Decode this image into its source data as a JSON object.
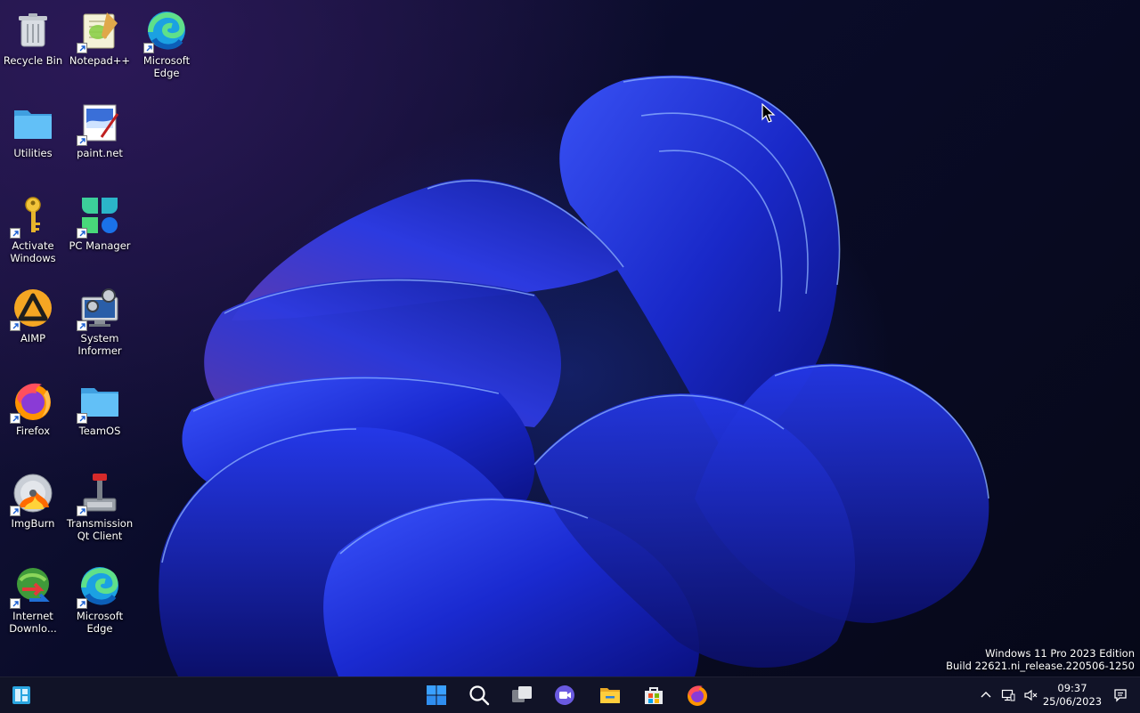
{
  "desktop": {
    "icons": [
      {
        "label": "Recycle Bin",
        "icon": "recycle-bin-icon"
      },
      {
        "label": "Notepad++",
        "icon": "notepad-plus-plus-icon"
      },
      {
        "label": "Microsoft Edge",
        "icon": "microsoft-edge-icon"
      },
      {
        "label": "Utilities",
        "icon": "folder-icon"
      },
      {
        "label": "paint.net",
        "icon": "paint-net-icon"
      },
      {
        "label": "Activate Windows",
        "icon": "key-icon"
      },
      {
        "label": "PC Manager",
        "icon": "pc-manager-icon"
      },
      {
        "label": "AIMP",
        "icon": "aimp-icon"
      },
      {
        "label": "System Informer",
        "icon": "system-informer-icon"
      },
      {
        "label": "Firefox",
        "icon": "firefox-icon"
      },
      {
        "label": "TeamOS",
        "icon": "folder-icon"
      },
      {
        "label": "ImgBurn",
        "icon": "imgburn-icon"
      },
      {
        "label": "Transmission Qt Client",
        "icon": "transmission-icon"
      },
      {
        "label": "Internet Downlo...",
        "icon": "internet-download-manager-icon"
      },
      {
        "label": "Microsoft Edge",
        "icon": "microsoft-edge-icon"
      }
    ]
  },
  "watermark": {
    "line1": "Windows 11 Pro 2023 Edition",
    "line2": "Build 22621.ni_release.220506-1250"
  },
  "taskbar": {
    "widgets_icon": "widgets-icon",
    "apps": [
      {
        "name": "start",
        "icon": "windows-start-icon"
      },
      {
        "name": "search",
        "icon": "search-icon"
      },
      {
        "name": "task-view",
        "icon": "task-view-icon"
      },
      {
        "name": "chat",
        "icon": "teams-chat-icon"
      },
      {
        "name": "file-explorer",
        "icon": "file-explorer-icon"
      },
      {
        "name": "microsoft-store",
        "icon": "microsoft-store-icon"
      },
      {
        "name": "firefox",
        "icon": "firefox-icon"
      }
    ],
    "tray": {
      "chevron_icon": "chevron-up-icon",
      "network_icon": "network-icon",
      "volume_icon": "volume-muted-icon",
      "time": "09:37",
      "date": "25/06/2023",
      "notification_icon": "notification-icon"
    }
  },
  "colors": {
    "accent": "#2f5bff",
    "taskbar": "#12142a",
    "folder": "#4fb6f5"
  }
}
